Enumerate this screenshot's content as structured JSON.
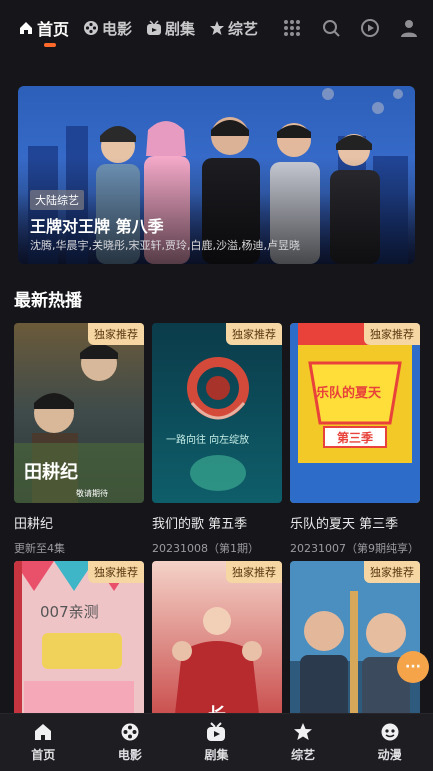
{
  "top_tabs": [
    {
      "label": "首页",
      "icon": "home-icon"
    },
    {
      "label": "电影",
      "icon": "film-reel-icon"
    },
    {
      "label": "剧集",
      "icon": "tv-icon"
    },
    {
      "label": "综艺",
      "icon": "star-icon"
    }
  ],
  "top_icons": [
    "grid-menu-icon",
    "search-icon",
    "play-history-icon",
    "user-icon"
  ],
  "banner": {
    "tag": "大陆综艺",
    "title": "王牌对王牌 第八季",
    "subtitle": "沈腾,华晨宇,关晓彤,宋亚轩,贾玲,白鹿,沙溢,杨迪,卢昱晓"
  },
  "section": {
    "title": "最新热播"
  },
  "cards": [
    {
      "badge": "独家推荐",
      "title": "田耕纪",
      "subtitle": "更新至4集",
      "poster_text": "田耕纪",
      "poster_caption": "敬请期待"
    },
    {
      "badge": "独家推荐",
      "title": "我们的歌 第五季",
      "subtitle": "20231008（第1期）",
      "poster_text": "一路向往 向左绽放"
    },
    {
      "badge": "独家推荐",
      "title": "乐队的夏天 第三季",
      "subtitle": "20231007（第9期纯享）",
      "poster_text": "乐队的夏天",
      "poster_caption": "第三季"
    },
    {
      "badge": "独家推荐",
      "title": "",
      "subtitle": "",
      "poster_text": "007亲测"
    },
    {
      "badge": "独家推荐",
      "title": "",
      "subtitle": "",
      "poster_text": "长"
    },
    {
      "badge": "独家推荐",
      "title": "",
      "subtitle": "",
      "poster_text": ""
    }
  ],
  "fab_label": "···",
  "bottom_nav": [
    {
      "label": "首页",
      "icon": "home-icon"
    },
    {
      "label": "电影",
      "icon": "film-reel-icon"
    },
    {
      "label": "剧集",
      "icon": "tv-icon"
    },
    {
      "label": "综艺",
      "icon": "star-icon"
    },
    {
      "label": "动漫",
      "icon": "anime-face-icon"
    }
  ],
  "colors": {
    "accent": "#ff6a2b",
    "badge_bg": "#f6d7a3",
    "background": "#16161a"
  }
}
